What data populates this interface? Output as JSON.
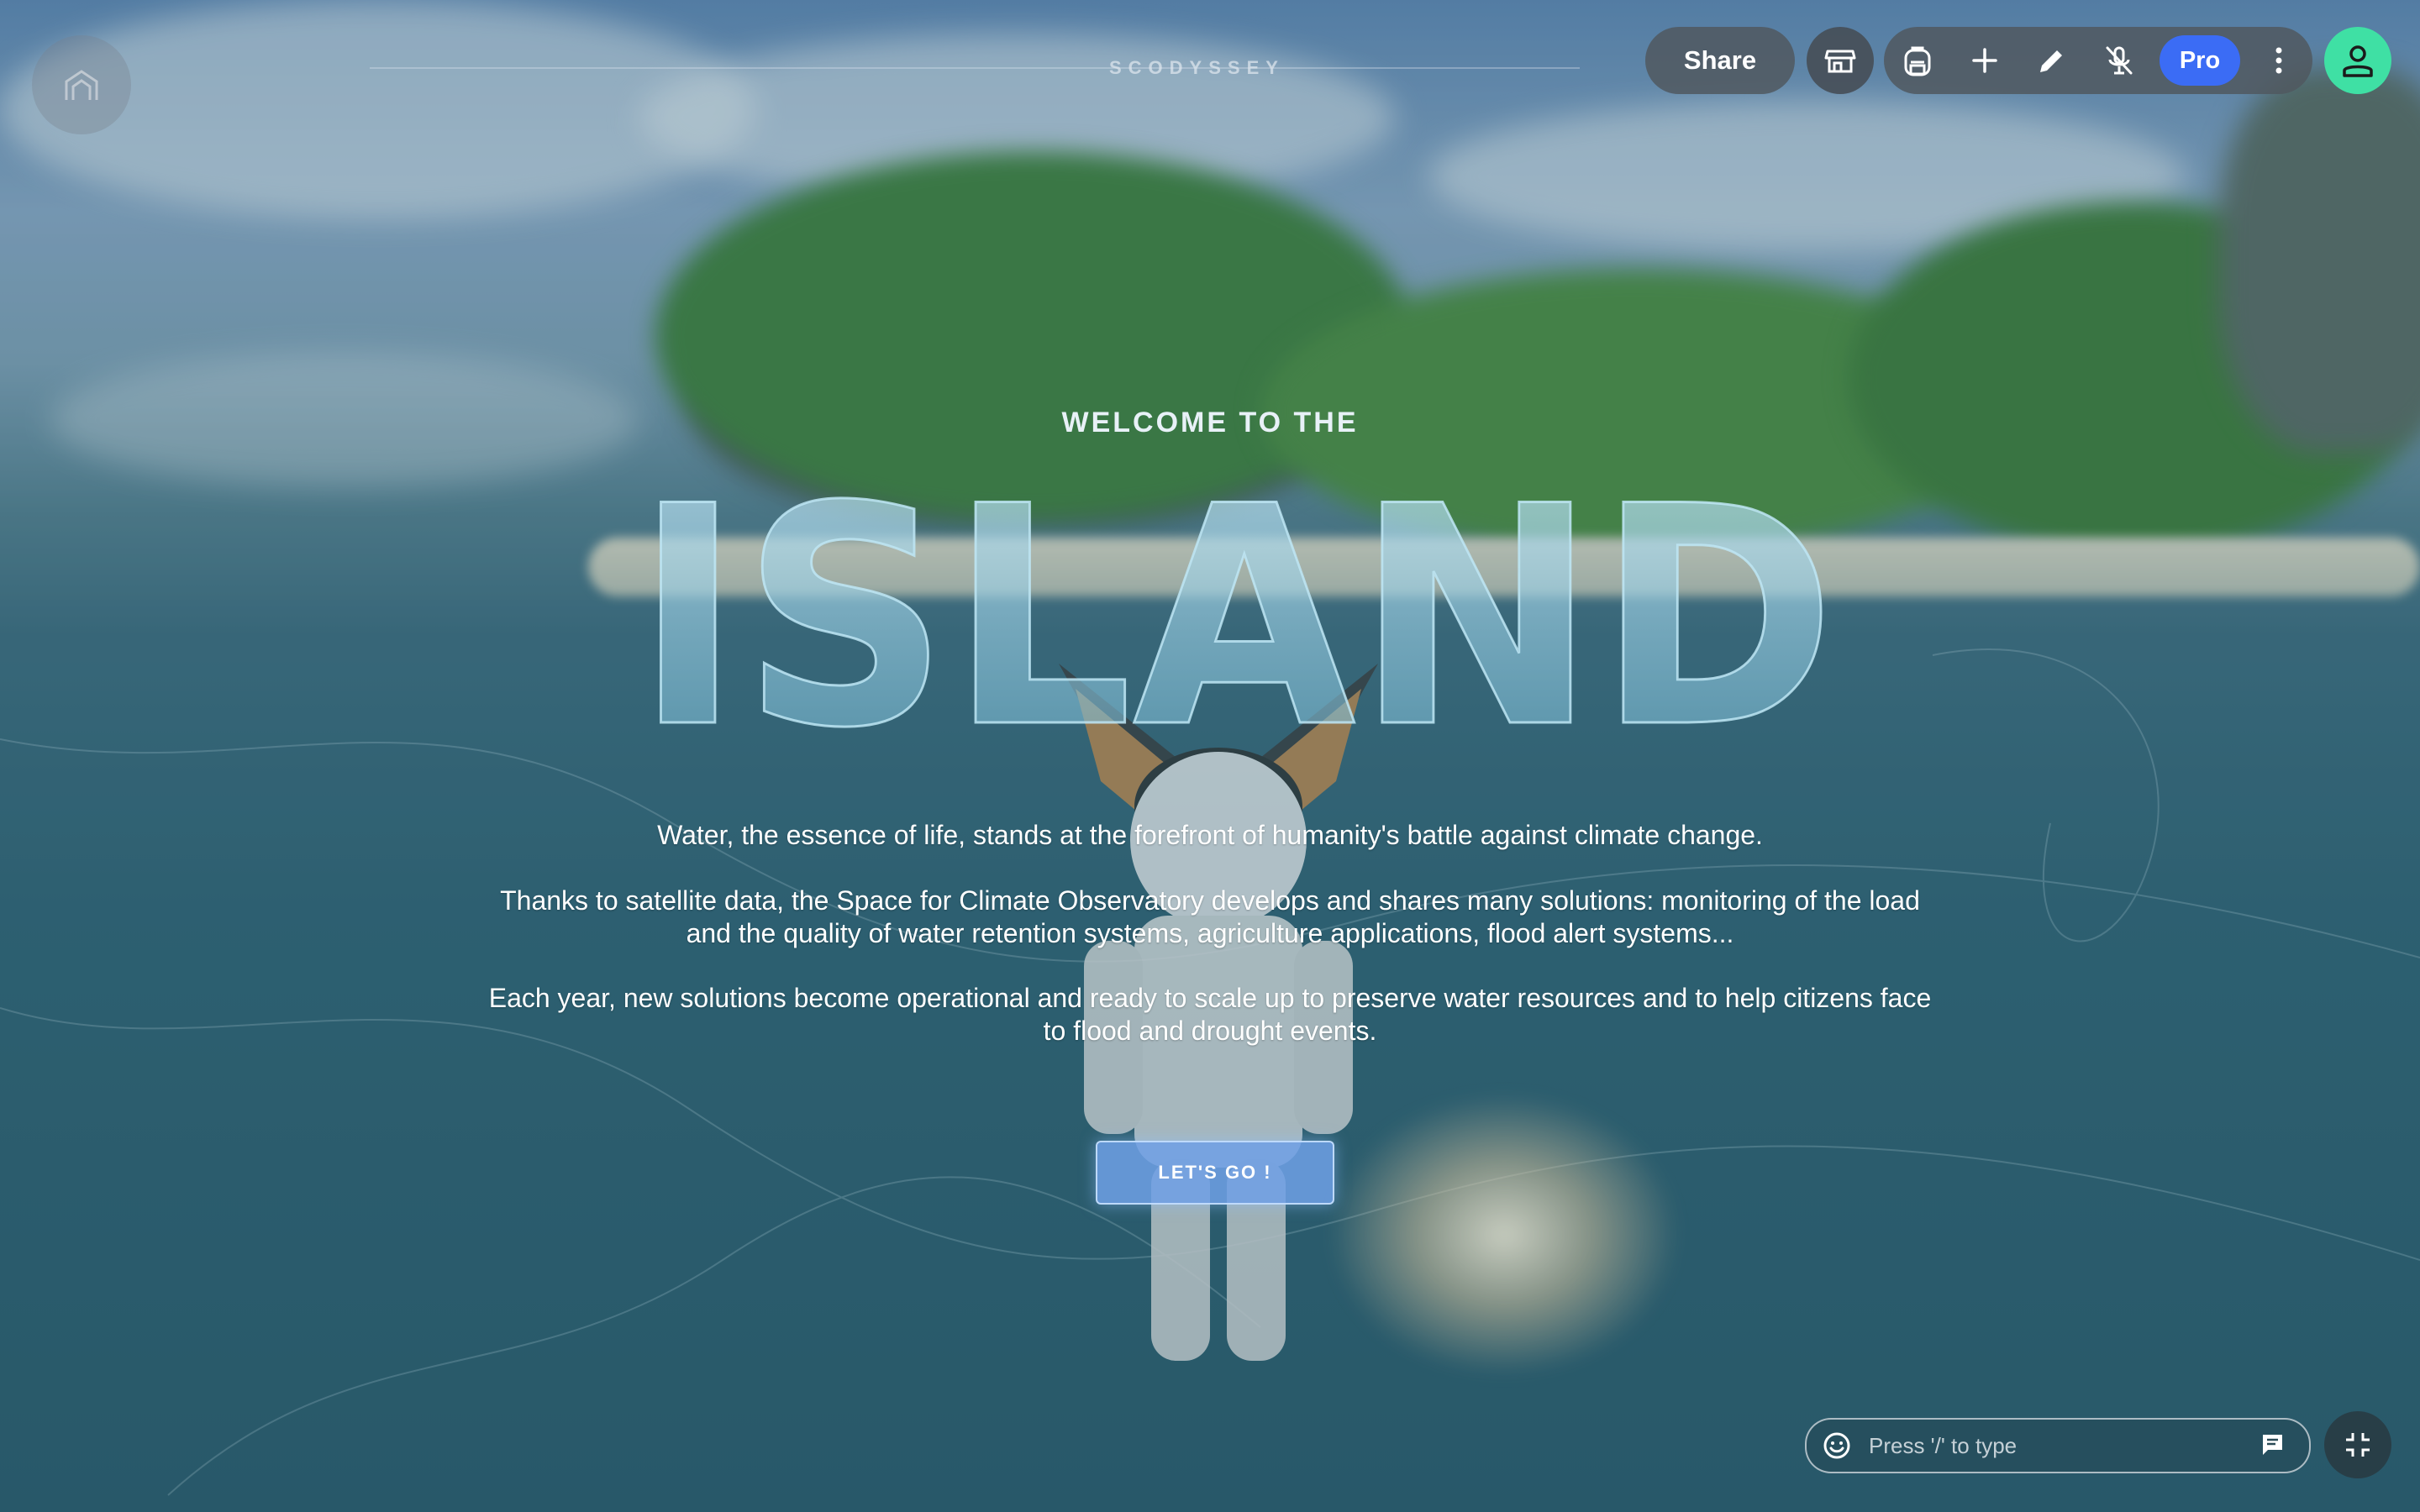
{
  "toolbar": {
    "brand": "SCODYSSEY",
    "share_label": "Share",
    "pro_label": "Pro",
    "icons": [
      "home-icon",
      "shop-icon",
      "backpack-icon",
      "plus-icon",
      "pencil-icon",
      "mic-off-icon",
      "more-vertical-icon",
      "user-icon"
    ]
  },
  "welcome": {
    "kicker": "WELCOME TO THE",
    "title": "ISLAND",
    "paragraph_1": "Water, the essence of life, stands at the forefront of humanity's battle against climate change.",
    "paragraph_2_line_1": "Thanks to satellite data, the Space for Climate Observatory develops and shares many solutions: monitoring of the load",
    "paragraph_2_line_2": "and the quality of water retention systems, agriculture applications, flood alert systems...",
    "paragraph_3_line_1": "Each year, new solutions become operational and ready to scale up to preserve water resources and to help citizens face",
    "paragraph_3_line_2": "to flood and drought events.",
    "cta_label": "LET'S GO !"
  },
  "chat": {
    "placeholder": "Press '/' to type"
  },
  "colors": {
    "pro_badge": "#3b6cf5",
    "avatar_button": "#3fe0a4",
    "cta": "#6ea0e6"
  }
}
